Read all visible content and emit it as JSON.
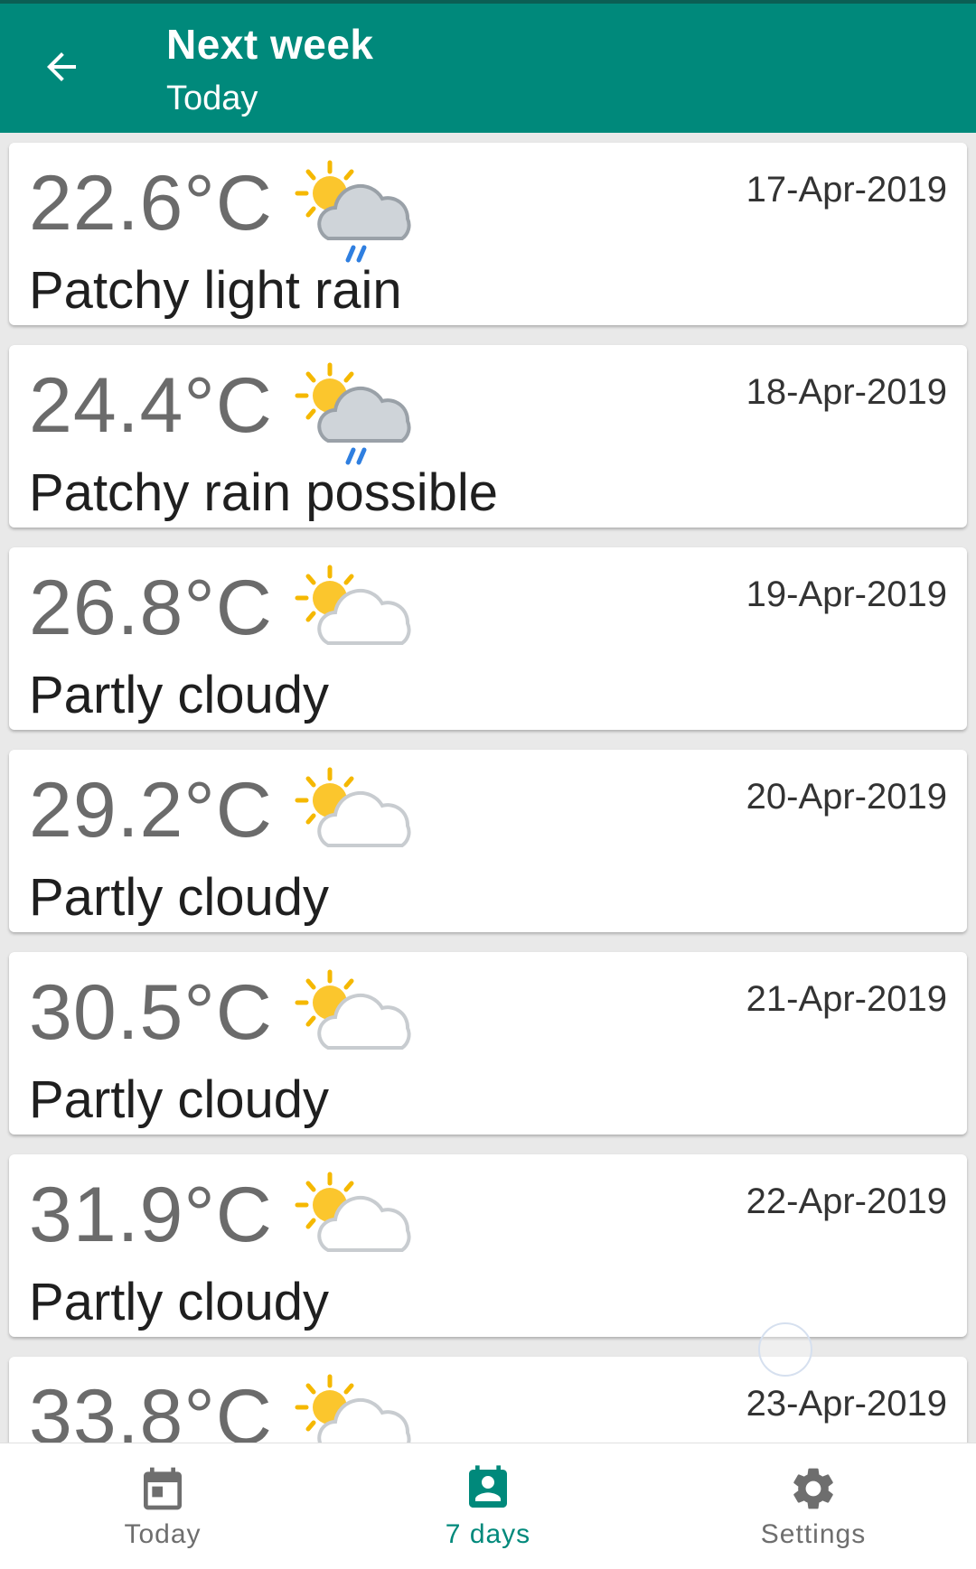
{
  "appbar": {
    "title": "Next week",
    "subtitle": "Today",
    "back_icon": "arrow-back-icon",
    "color": "#00897b"
  },
  "forecast": [
    {
      "temp": "22.6°C",
      "condition": "Patchy light rain",
      "date": "17-Apr-2019",
      "icon": "sun-cloud-rain-icon"
    },
    {
      "temp": "24.4°C",
      "condition": "Patchy rain possible",
      "date": "18-Apr-2019",
      "icon": "sun-cloud-rain-icon"
    },
    {
      "temp": "26.8°C",
      "condition": "Partly cloudy",
      "date": "19-Apr-2019",
      "icon": "partly-cloudy-icon"
    },
    {
      "temp": "29.2°C",
      "condition": "Partly cloudy",
      "date": "20-Apr-2019",
      "icon": "partly-cloudy-icon"
    },
    {
      "temp": "30.5°C",
      "condition": "Partly cloudy",
      "date": "21-Apr-2019",
      "icon": "partly-cloudy-icon"
    },
    {
      "temp": "31.9°C",
      "condition": "Partly cloudy",
      "date": "22-Apr-2019",
      "icon": "partly-cloudy-icon"
    },
    {
      "temp": "33.8°C",
      "condition": "",
      "date": "23-Apr-2019",
      "icon": "partly-cloudy-icon"
    }
  ],
  "bottom_nav": {
    "items": [
      {
        "label": "Today",
        "icon": "calendar-icon",
        "active": false
      },
      {
        "label": "7 days",
        "icon": "contact-calendar-icon",
        "active": true
      },
      {
        "label": "Settings",
        "icon": "gear-icon",
        "active": false
      }
    ],
    "active_color": "#00897b",
    "inactive_color": "#6e6e6e"
  }
}
